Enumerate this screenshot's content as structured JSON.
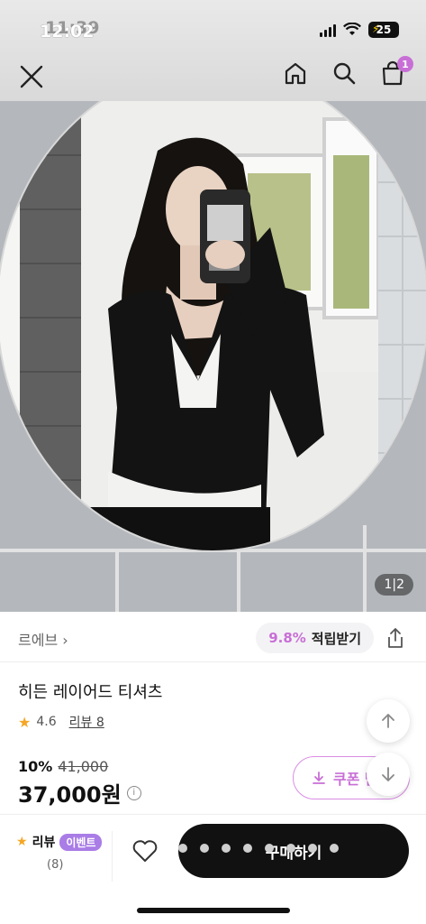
{
  "status_bar": {
    "time": "12:02",
    "time_overlay": "11:39",
    "battery": "25"
  },
  "gallery": {
    "counter": "1|2",
    "current": 1,
    "total": 2
  },
  "nav": {
    "cart_count": "1"
  },
  "brand": {
    "name": "르에브 ›"
  },
  "points": {
    "rate": "9.8%",
    "label": "적립받기"
  },
  "product": {
    "title": "히든 레이어드 티셔츠",
    "rating": "4.6",
    "review_link": "리뷰 8",
    "discount_rate": "10%",
    "original_price": "41,000",
    "price": "37,000원"
  },
  "coupon": {
    "label": "쿠폰 받"
  },
  "bottom": {
    "review_label": "리뷰",
    "event_badge": "이벤트",
    "review_count": "(8)",
    "buy_label": "구매하기"
  },
  "colors": {
    "accent": "#c86fd6",
    "event": "#a97ce6",
    "buy_button": "#111111",
    "star": "#f5a623"
  }
}
